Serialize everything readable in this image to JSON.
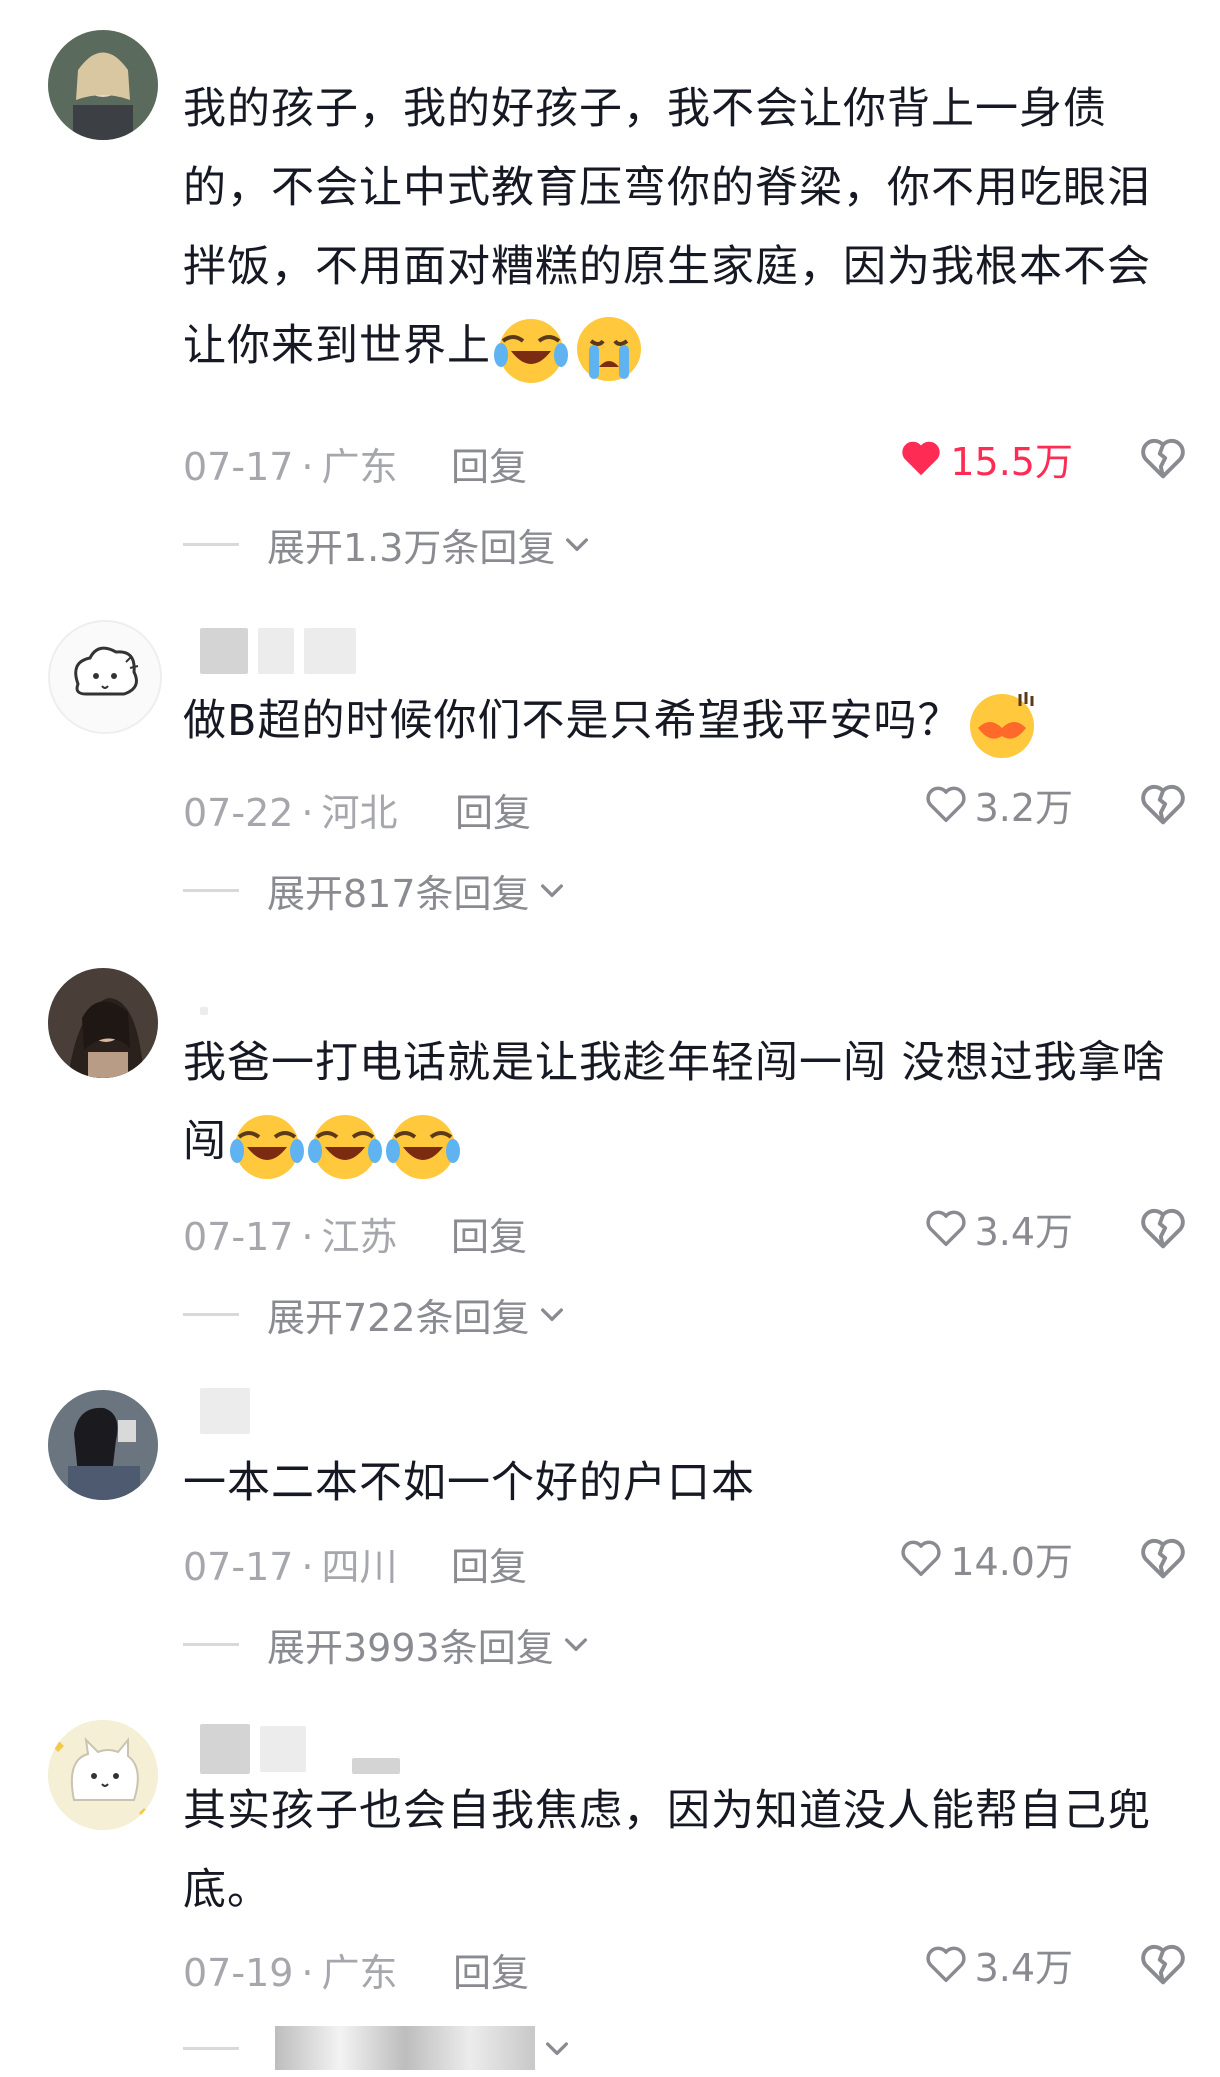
{
  "comments": [
    {
      "text": "我的孩子，我的好孩子，我不会让你背上一身债的，不会让中式教育压弯你的脊梁，你不用吃眼泪拌饭，不用面对糟糕的原生家庭，因为我根本不会让你来到世界上",
      "emojis": [
        "laugh-cry-emoji",
        "crying-emoji"
      ],
      "date": "07-17",
      "location": "广东",
      "reply_label": "回复",
      "likes": "15.5万",
      "liked": true,
      "expand_label": "展开1.3万条回复"
    },
    {
      "text": "做B超的时候你们不是只希望我平安吗？",
      "emojis": [
        "kiss-lips-emoji"
      ],
      "date": "07-22",
      "location": "河北",
      "reply_label": "回复",
      "likes": "3.2万",
      "liked": false,
      "expand_label": "展开817条回复"
    },
    {
      "text": "我爸一打电话就是让我趁年轻闯一闯 没想过我拿啥闯",
      "emojis": [
        "laugh-cry-emoji",
        "laugh-cry-emoji",
        "laugh-cry-emoji"
      ],
      "date": "07-17",
      "location": "江苏",
      "reply_label": "回复",
      "likes": "3.4万",
      "liked": false,
      "expand_label": "展开722条回复"
    },
    {
      "text": "一本二本不如一个好的户口本",
      "emojis": [],
      "date": "07-17",
      "location": "四川",
      "reply_label": "回复",
      "likes": "14.0万",
      "liked": false,
      "expand_label": "展开3993条回复"
    },
    {
      "text": "其实孩子也会自我焦虑，因为知道没人能帮自己兜底。",
      "emojis": [],
      "date": "07-19",
      "location": "广东",
      "reply_label": "回复",
      "likes": "3.4万",
      "liked": false,
      "expand_label": ""
    }
  ],
  "colors": {
    "like_active": "#fe2c55",
    "meta_text": "#a6a7ac",
    "body_text": "#161823"
  },
  "icons": {
    "like": "heart-icon",
    "dislike": "broken-heart-icon",
    "expand": "chevron-down-icon"
  }
}
